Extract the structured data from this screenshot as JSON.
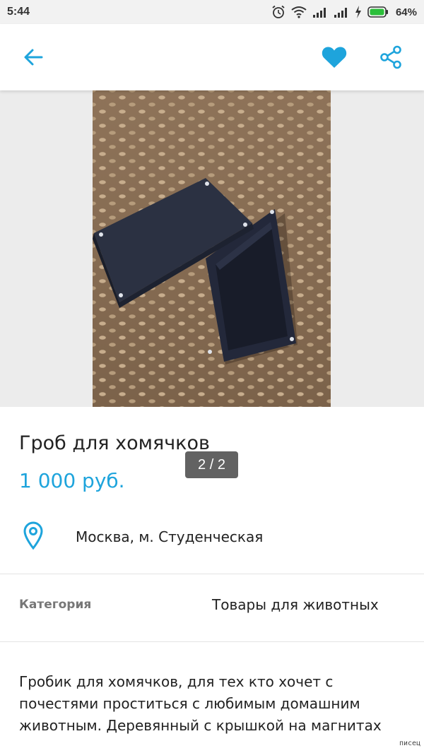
{
  "status_bar": {
    "time": "5:44",
    "battery_percent": "64%",
    "icons": [
      "alarm-icon",
      "wifi-icon",
      "signal-icon",
      "signal-icon",
      "charging-icon",
      "battery-icon"
    ],
    "battery_color": "#2bbf3a"
  },
  "app_bar": {
    "icons": [
      "back-arrow-icon",
      "heart-icon",
      "share-icon"
    ],
    "accent_color": "#1ea4dc"
  },
  "gallery": {
    "counter": "2 / 2"
  },
  "listing": {
    "title": "Гроб для хомячков",
    "price": "1 000 руб.",
    "location": "Москва, м. Студенческая"
  },
  "details": {
    "category_label": "Категория",
    "category_value": "Товары для животных"
  },
  "description": "Гробик для хомячков, для тех кто хочет с почестями проститься с любимым домашним животным. Деревянный с крышкой на магнитах",
  "watermark": "писец"
}
